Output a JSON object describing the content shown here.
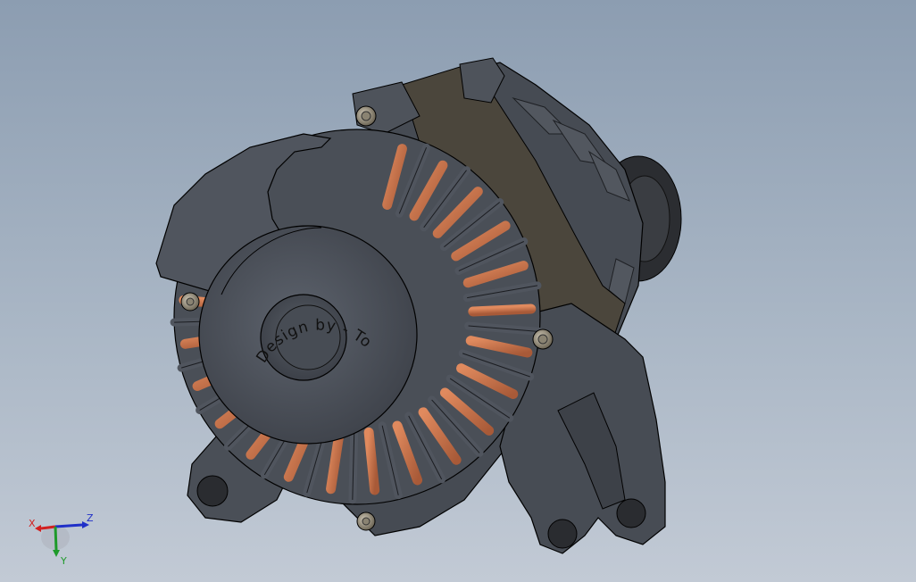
{
  "viewport": {
    "background_top": "#8c9db1",
    "background_bottom": "#c2cad5"
  },
  "model": {
    "engraved_text": "Design by - Tom Kirkup",
    "body_color": "#4a4f58",
    "body_light": "#5c626c",
    "coil_color": "#c8704a",
    "band_color": "#4b463c"
  },
  "triad": {
    "x_label": "X",
    "y_label": "Y",
    "z_label": "Z",
    "x_color": "#d22020",
    "y_color": "#1e9a2a",
    "z_color": "#2030c8"
  }
}
